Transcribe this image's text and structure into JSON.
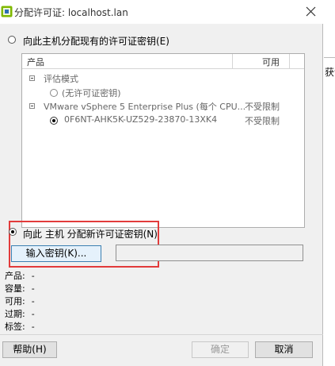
{
  "window": {
    "title": "分配许可证: localhost.lan",
    "app_icon": "vmware-icon",
    "close_icon": "close-icon"
  },
  "background": {
    "text": "获讠"
  },
  "options": {
    "existing_label": "向此主机分配现有的许可证密钥(E)",
    "existing_selected": false,
    "new_label": "向此 主机 分配新许可证密钥(N)",
    "new_selected": true
  },
  "list": {
    "columns": [
      "产品",
      "可用"
    ],
    "rows": [
      {
        "type": "group",
        "label": "评估模式",
        "available": ""
      },
      {
        "type": "radio",
        "label": "(无许可证密钥)",
        "available": "",
        "selected": false
      },
      {
        "type": "group",
        "label": "VMware vSphere 5 Enterprise Plus (每个 CPU...",
        "available": "不受限制"
      },
      {
        "type": "radio",
        "label": "0F6NT-AHK5K-UZ529-23870-13XK4",
        "available": "不受限制",
        "selected": true
      }
    ]
  },
  "enter_key_button": "输入密钥(K)...",
  "key_field_value": "",
  "info": [
    {
      "label": "产品:",
      "value": "-"
    },
    {
      "label": "容量:",
      "value": "-"
    },
    {
      "label": "可用:",
      "value": "-"
    },
    {
      "label": "过期:",
      "value": "-"
    },
    {
      "label": "标签:",
      "value": "-"
    }
  ],
  "buttons": {
    "help": "帮助(H)",
    "ok": "确定",
    "cancel": "取消"
  },
  "colors": {
    "highlight": "#e23b3b",
    "window_bg": "#f0f0f0"
  }
}
